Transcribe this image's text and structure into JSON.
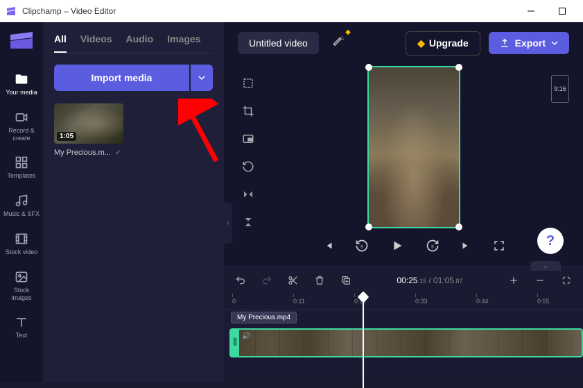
{
  "titlebar": {
    "title": "Clipchamp – Video Editor"
  },
  "rail": [
    {
      "label": "Your media",
      "icon": "folder-icon",
      "active": true
    },
    {
      "label": "Record & create",
      "icon": "camera-icon"
    },
    {
      "label": "Templates",
      "icon": "templates-icon"
    },
    {
      "label": "Music & SFX",
      "icon": "music-icon"
    },
    {
      "label": "Stock video",
      "icon": "film-icon"
    },
    {
      "label": "Stock images",
      "icon": "image-icon"
    },
    {
      "label": "Text",
      "icon": "text-icon"
    }
  ],
  "media_tabs": [
    "All",
    "Videos",
    "Audio",
    "Images"
  ],
  "import_label": "Import media",
  "media_item": {
    "name": "My Precious.m...",
    "duration": "1:05"
  },
  "topbar": {
    "title": "Untitled video",
    "upgrade": "Upgrade",
    "export": "Export"
  },
  "aspect": "9:16",
  "timeline": {
    "current": "00:25",
    "current_ms": ".15",
    "total": "01:05",
    "total_ms": ".87",
    "ticks": [
      "0",
      "0:11",
      "0:22",
      "0:33",
      "0:44",
      "0:55"
    ],
    "clip_name": "My Precious.mp4"
  },
  "playhead_left_pct": 39
}
